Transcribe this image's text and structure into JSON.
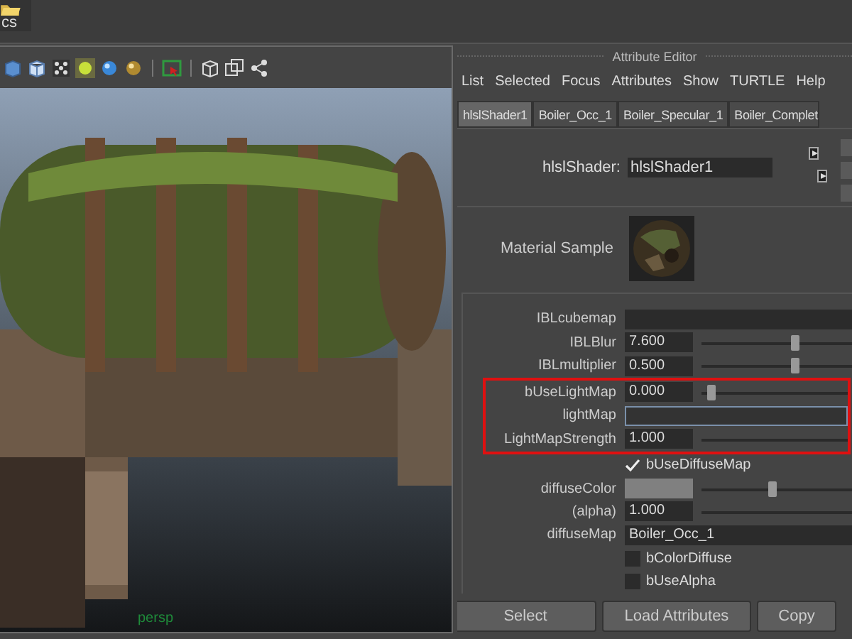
{
  "top_strip": {
    "label": "cs"
  },
  "viewport": {
    "camera_label": "persp"
  },
  "attribute_editor": {
    "title": "Attribute Editor",
    "menu": [
      "List",
      "Selected",
      "Focus",
      "Attributes",
      "Show",
      "TURTLE",
      "Help"
    ],
    "tabs": [
      {
        "label": "hlslShader1",
        "selected": true
      },
      {
        "label": "Boiler_Occ_1",
        "selected": false
      },
      {
        "label": "Boiler_Specular_1",
        "selected": false
      },
      {
        "label": "Boiler_Complet",
        "selected": false
      }
    ],
    "node_field": {
      "label": "hlslShader:",
      "value": "hlslShader1"
    },
    "material_sample": {
      "label": "Material Sample"
    },
    "attributes": [
      {
        "kind": "field",
        "label": "IBLcubemap",
        "focused": false,
        "highlighted": false
      },
      {
        "kind": "slider",
        "label": "IBLBlur",
        "value": "7.600",
        "level": 0.63,
        "highlighted": false
      },
      {
        "kind": "slider",
        "label": "IBLmultiplier",
        "value": "0.500",
        "level": 0.63,
        "highlighted": false
      },
      {
        "kind": "slider",
        "label": "bUseLightMap",
        "value": "0.000",
        "level": 0.04,
        "highlighted": true
      },
      {
        "kind": "field",
        "label": "lightMap",
        "focused": true,
        "highlighted": true
      },
      {
        "kind": "slider",
        "label": "LightMapStrength",
        "value": "1.000",
        "highlighted": true
      },
      {
        "kind": "checkbox",
        "label": "bUseDiffuseMap",
        "checked": true,
        "highlighted": false
      },
      {
        "kind": "color_slider",
        "label": "diffuseColor",
        "level": 0.47,
        "highlighted": false
      },
      {
        "kind": "slider",
        "label": "(alpha)",
        "value": "1.000",
        "highlighted": false
      },
      {
        "kind": "field",
        "label": "diffuseMap",
        "value": "Boiler_Occ_1",
        "focused": false,
        "highlighted": false
      },
      {
        "kind": "checkbox",
        "label": "bColorDiffuse",
        "checked": false,
        "highlighted": false
      },
      {
        "kind": "checkbox",
        "label": "bUseAlpha",
        "checked": false,
        "highlighted": false
      }
    ],
    "buttons": [
      "Select",
      "Load Attributes",
      "Copy"
    ]
  }
}
